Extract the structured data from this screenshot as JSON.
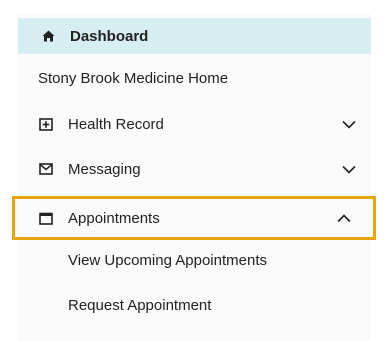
{
  "nav": {
    "dashboard": {
      "label": "Dashboard",
      "icon": "home-icon"
    },
    "home": {
      "label": "Stony Brook Medicine Home"
    },
    "health_record": {
      "label": "Health Record",
      "icon": "health-record-icon",
      "chevron": "chevron-down-icon"
    },
    "messaging": {
      "label": "Messaging",
      "icon": "envelope-icon",
      "chevron": "chevron-down-icon"
    },
    "appointments": {
      "label": "Appointments",
      "icon": "calendar-icon",
      "chevron": "chevron-up-icon",
      "expanded": true,
      "highlighted": true,
      "items": [
        {
          "label": "View Upcoming Appointments"
        },
        {
          "label": "Request Appointment"
        }
      ]
    }
  },
  "colors": {
    "dashboard_bg": "#d6eef1",
    "highlight_border": "#e8a50a",
    "panel_bg": "#fafafa",
    "text": "#222222"
  }
}
